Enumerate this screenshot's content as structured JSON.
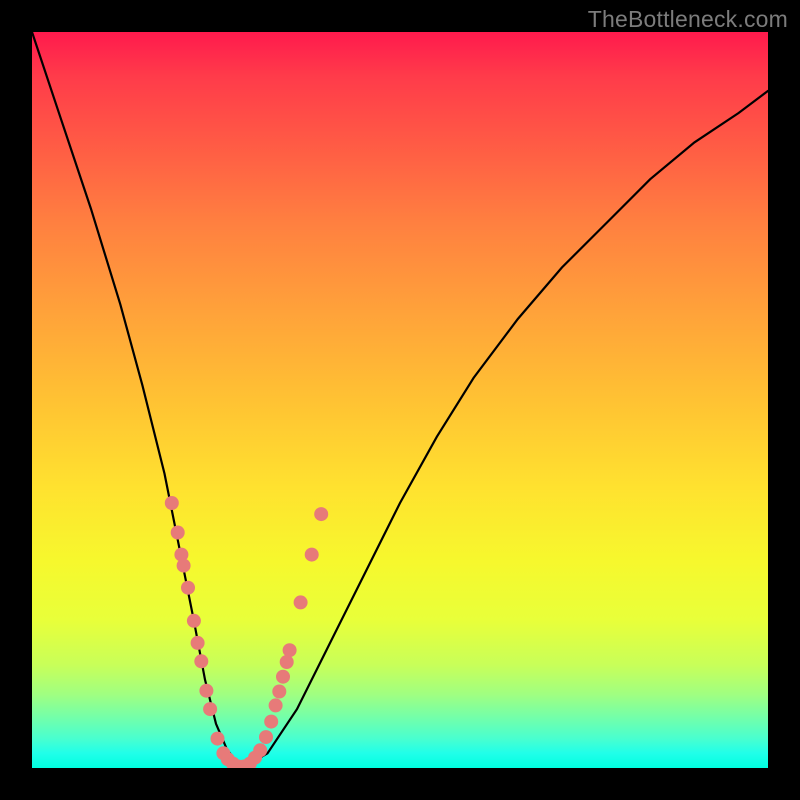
{
  "watermark": {
    "text": "TheBottleneck.com"
  },
  "chart_data": {
    "type": "line",
    "title": "",
    "xlabel": "",
    "ylabel": "",
    "xlim": [
      0,
      100
    ],
    "ylim": [
      0,
      100
    ],
    "grid": false,
    "legend": false,
    "series": [
      {
        "name": "curve",
        "x": [
          0,
          4,
          8,
          12,
          15,
          18,
          20,
          22,
          23.5,
          25,
          26.5,
          28.5,
          32,
          36,
          40,
          45,
          50,
          55,
          60,
          66,
          72,
          78,
          84,
          90,
          96,
          100
        ],
        "y": [
          100,
          88,
          76,
          63,
          52,
          40,
          30,
          20,
          12,
          6,
          2.5,
          0,
          2,
          8,
          16,
          26,
          36,
          45,
          53,
          61,
          68,
          74,
          80,
          85,
          89,
          92
        ]
      }
    ],
    "points": {
      "name": "markers",
      "color": "#e77a79",
      "xy": [
        [
          19.0,
          36.0
        ],
        [
          19.8,
          32.0
        ],
        [
          20.3,
          29.0
        ],
        [
          20.6,
          27.5
        ],
        [
          21.2,
          24.5
        ],
        [
          22.0,
          20.0
        ],
        [
          22.5,
          17.0
        ],
        [
          23.0,
          14.5
        ],
        [
          23.7,
          10.5
        ],
        [
          24.2,
          8.0
        ],
        [
          25.2,
          4.0
        ],
        [
          26.0,
          2.0
        ],
        [
          26.6,
          1.2
        ],
        [
          27.3,
          0.6
        ],
        [
          28.0,
          0.2
        ],
        [
          28.8,
          0.2
        ],
        [
          29.6,
          0.6
        ],
        [
          30.3,
          1.4
        ],
        [
          31.0,
          2.4
        ],
        [
          31.8,
          4.2
        ],
        [
          32.5,
          6.3
        ],
        [
          33.1,
          8.5
        ],
        [
          33.6,
          10.4
        ],
        [
          34.1,
          12.4
        ],
        [
          34.6,
          14.4
        ],
        [
          35.0,
          16.0
        ],
        [
          36.5,
          22.5
        ],
        [
          38.0,
          29.0
        ],
        [
          39.3,
          34.5
        ]
      ]
    },
    "background": {
      "gradient_stops": [
        {
          "pos": 0.0,
          "color": "#ff1a4d"
        },
        {
          "pos": 0.5,
          "color": "#ffc233"
        },
        {
          "pos": 0.8,
          "color": "#e8ff3a"
        },
        {
          "pos": 1.0,
          "color": "#00ffe0"
        }
      ]
    }
  }
}
